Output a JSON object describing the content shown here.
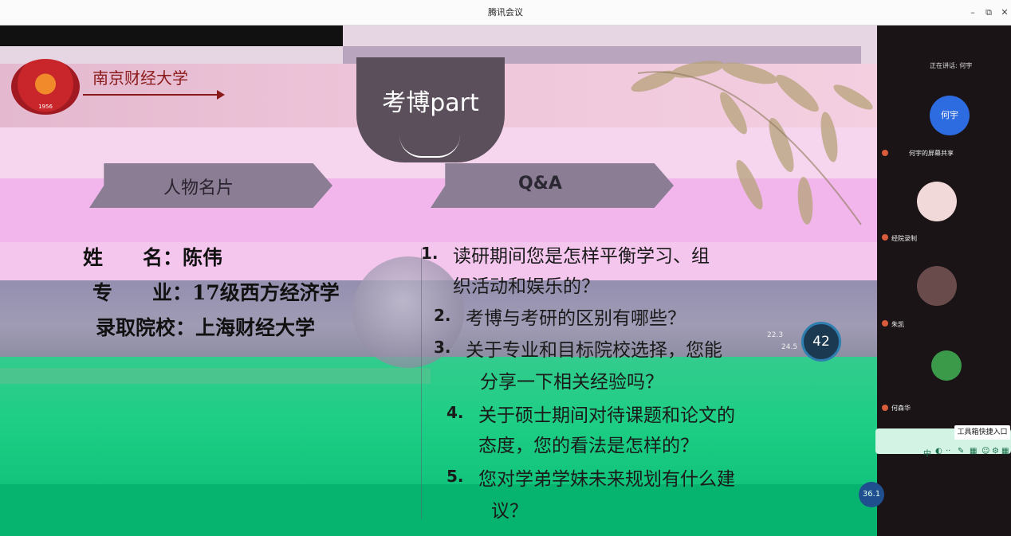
{
  "window": {
    "title": "腾讯会议",
    "minimize": "–",
    "restore": "⧉",
    "close": "✕"
  },
  "slide": {
    "logo_year": "1956",
    "school_name": "南京财经大学",
    "badge_title": "考博part",
    "sections": {
      "left": "人物名片",
      "right": "Q&A"
    },
    "profile": {
      "name_line": "姓　　名：陈伟",
      "major_line": "专　　业：17级西方经济学",
      "admit_line": "录取院校：上海财经大学"
    },
    "questions": [
      {
        "num": "1.",
        "lines": [
          "读研期间您是怎样平衡学习、组",
          "织活动和娱乐的？"
        ]
      },
      {
        "num": "2.",
        "lines": [
          "考博与考研的区别有哪些？"
        ]
      },
      {
        "num": "3.",
        "lines": [
          "关于专业和目标院校选择，您能",
          "分享一下相关经验吗？"
        ]
      },
      {
        "num": "4.",
        "lines": [
          "关于硕士期间对待课题和论文的",
          "态度，您的看法是怎样的？"
        ]
      },
      {
        "num": "5.",
        "lines": [
          "您对学弟学妹未来规划有什么建",
          "议？"
        ]
      }
    ],
    "timer_value": "42",
    "temp_top": "22.3",
    "temp_bottom": "24.5",
    "time_badge": "36.1"
  },
  "sidebar": {
    "speaking_label": "正在讲话: 何宇",
    "participants": [
      {
        "avatar_text": "何宇",
        "name": "何宇的屏幕共享",
        "color": "#2d6be0"
      },
      {
        "avatar_text": "",
        "name": "经院录制",
        "color": "#f1d9d9"
      },
      {
        "avatar_text": "",
        "name": "朱凯",
        "color": "#6a4b4b"
      },
      {
        "avatar_text": "",
        "name": "何森华",
        "color": "#3a9a4a"
      }
    ],
    "shortcut_label": "工具箱快捷入口",
    "toolbar_icons": [
      "中",
      "◐",
      "··",
      "✎",
      "▦",
      "☺",
      "⚙",
      "▦"
    ]
  }
}
